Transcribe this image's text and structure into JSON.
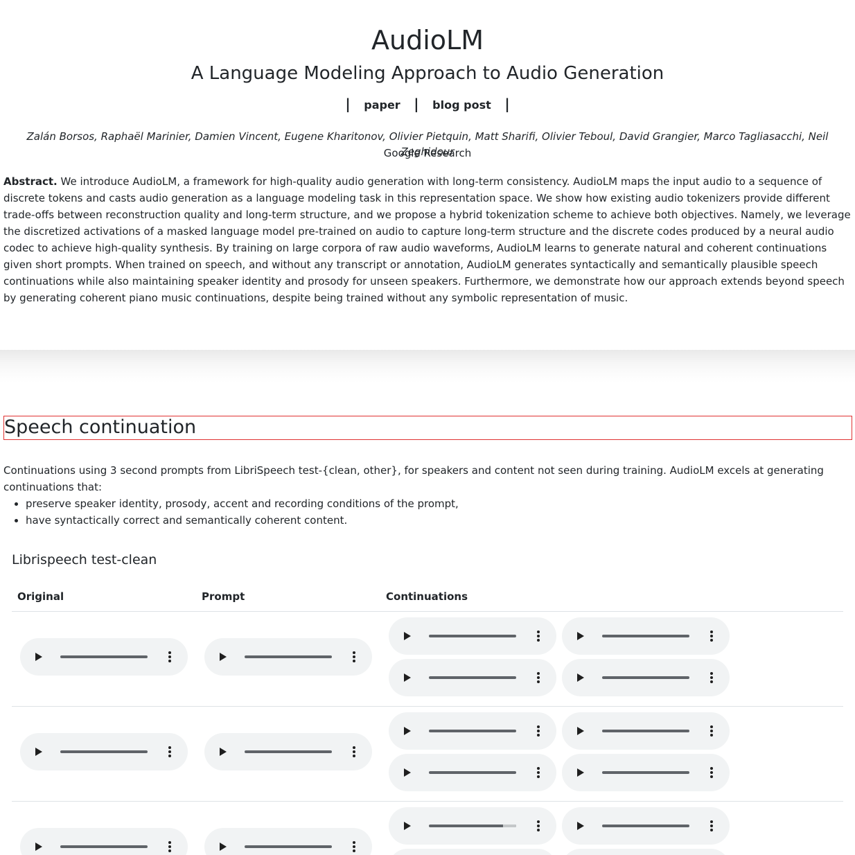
{
  "header": {
    "title": "AudioLM",
    "subtitle": "A Language Modeling Approach to Audio Generation",
    "separator": "|",
    "links": [
      {
        "label": "paper"
      },
      {
        "label": "blog post"
      }
    ],
    "authors": "Zalán Borsos, Raphaël Marinier, Damien Vincent, Eugene Kharitonov, Olivier Pietquin, Matt Sharifi, Olivier Teboul, David Grangier, Marco Tagliasacchi, Neil Zeghidour",
    "affiliation": "Google Research"
  },
  "abstract": {
    "label": "Abstract.",
    "text": " We introduce AudioLM, a framework for high-quality audio generation with long-term consistency. AudioLM maps the input audio to a sequence of discrete tokens and casts audio generation as a language modeling task in this representation space. We show how existing audio tokenizers provide different trade-offs between reconstruction quality and long-term structure, and we propose a hybrid tokenization scheme to achieve both objectives. Namely, we leverage the discretized activations of a masked language model pre-trained on audio to capture long-term structure and the discrete codes produced by a neural audio codec to achieve high-quality synthesis. By training on large corpora of raw audio waveforms, AudioLM learns to generate natural and coherent continuations given short prompts. When trained on speech, and without any transcript or annotation, AudioLM generates syntactically and semantically plausible speech continuations while also maintaining speaker identity and prosody for unseen speakers. Furthermore, we demonstrate how our approach extends beyond speech by generating coherent piano music continuations, despite being trained without any symbolic representation of music."
  },
  "section": {
    "title": "Speech continuation",
    "intro": "Continuations using 3 second prompts from LibriSpeech test-{clean, other}, for speakers and content not seen during training. AudioLM excels at generating continuations that:",
    "bullets": [
      "preserve speaker identity, prosody, accent and recording conditions of the prompt,",
      "have syntactically correct and semantically coherent content."
    ],
    "subsection": "Librispeech test-clean",
    "table": {
      "headers": [
        "Original",
        "Prompt",
        "Continuations"
      ]
    }
  },
  "audio_players": {
    "playback_progress": {
      "row3_continuation1": 0.85
    }
  },
  "colors": {
    "text": "#212529",
    "player_bg": "#f1f3f4",
    "highlight_border": "#e03131",
    "table_rule": "#dee2e6"
  }
}
